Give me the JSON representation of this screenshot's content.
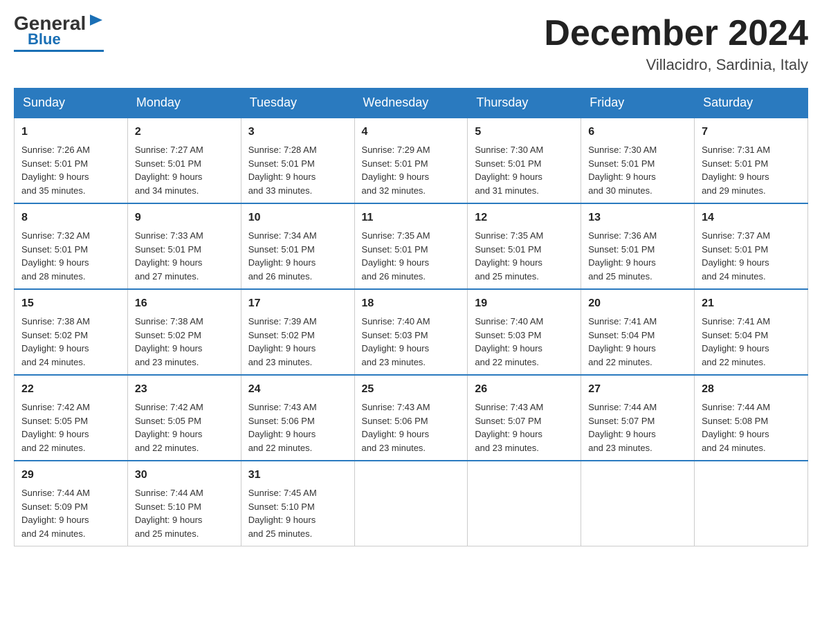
{
  "logo": {
    "general": "General",
    "blue": "Blue"
  },
  "header": {
    "month_year": "December 2024",
    "location": "Villacidro, Sardinia, Italy"
  },
  "weekdays": [
    "Sunday",
    "Monday",
    "Tuesday",
    "Wednesday",
    "Thursday",
    "Friday",
    "Saturday"
  ],
  "weeks": [
    [
      {
        "day": "1",
        "sunrise": "Sunrise: 7:26 AM",
        "sunset": "Sunset: 5:01 PM",
        "daylight": "Daylight: 9 hours",
        "daylight2": "and 35 minutes."
      },
      {
        "day": "2",
        "sunrise": "Sunrise: 7:27 AM",
        "sunset": "Sunset: 5:01 PM",
        "daylight": "Daylight: 9 hours",
        "daylight2": "and 34 minutes."
      },
      {
        "day": "3",
        "sunrise": "Sunrise: 7:28 AM",
        "sunset": "Sunset: 5:01 PM",
        "daylight": "Daylight: 9 hours",
        "daylight2": "and 33 minutes."
      },
      {
        "day": "4",
        "sunrise": "Sunrise: 7:29 AM",
        "sunset": "Sunset: 5:01 PM",
        "daylight": "Daylight: 9 hours",
        "daylight2": "and 32 minutes."
      },
      {
        "day": "5",
        "sunrise": "Sunrise: 7:30 AM",
        "sunset": "Sunset: 5:01 PM",
        "daylight": "Daylight: 9 hours",
        "daylight2": "and 31 minutes."
      },
      {
        "day": "6",
        "sunrise": "Sunrise: 7:30 AM",
        "sunset": "Sunset: 5:01 PM",
        "daylight": "Daylight: 9 hours",
        "daylight2": "and 30 minutes."
      },
      {
        "day": "7",
        "sunrise": "Sunrise: 7:31 AM",
        "sunset": "Sunset: 5:01 PM",
        "daylight": "Daylight: 9 hours",
        "daylight2": "and 29 minutes."
      }
    ],
    [
      {
        "day": "8",
        "sunrise": "Sunrise: 7:32 AM",
        "sunset": "Sunset: 5:01 PM",
        "daylight": "Daylight: 9 hours",
        "daylight2": "and 28 minutes."
      },
      {
        "day": "9",
        "sunrise": "Sunrise: 7:33 AM",
        "sunset": "Sunset: 5:01 PM",
        "daylight": "Daylight: 9 hours",
        "daylight2": "and 27 minutes."
      },
      {
        "day": "10",
        "sunrise": "Sunrise: 7:34 AM",
        "sunset": "Sunset: 5:01 PM",
        "daylight": "Daylight: 9 hours",
        "daylight2": "and 26 minutes."
      },
      {
        "day": "11",
        "sunrise": "Sunrise: 7:35 AM",
        "sunset": "Sunset: 5:01 PM",
        "daylight": "Daylight: 9 hours",
        "daylight2": "and 26 minutes."
      },
      {
        "day": "12",
        "sunrise": "Sunrise: 7:35 AM",
        "sunset": "Sunset: 5:01 PM",
        "daylight": "Daylight: 9 hours",
        "daylight2": "and 25 minutes."
      },
      {
        "day": "13",
        "sunrise": "Sunrise: 7:36 AM",
        "sunset": "Sunset: 5:01 PM",
        "daylight": "Daylight: 9 hours",
        "daylight2": "and 25 minutes."
      },
      {
        "day": "14",
        "sunrise": "Sunrise: 7:37 AM",
        "sunset": "Sunset: 5:01 PM",
        "daylight": "Daylight: 9 hours",
        "daylight2": "and 24 minutes."
      }
    ],
    [
      {
        "day": "15",
        "sunrise": "Sunrise: 7:38 AM",
        "sunset": "Sunset: 5:02 PM",
        "daylight": "Daylight: 9 hours",
        "daylight2": "and 24 minutes."
      },
      {
        "day": "16",
        "sunrise": "Sunrise: 7:38 AM",
        "sunset": "Sunset: 5:02 PM",
        "daylight": "Daylight: 9 hours",
        "daylight2": "and 23 minutes."
      },
      {
        "day": "17",
        "sunrise": "Sunrise: 7:39 AM",
        "sunset": "Sunset: 5:02 PM",
        "daylight": "Daylight: 9 hours",
        "daylight2": "and 23 minutes."
      },
      {
        "day": "18",
        "sunrise": "Sunrise: 7:40 AM",
        "sunset": "Sunset: 5:03 PM",
        "daylight": "Daylight: 9 hours",
        "daylight2": "and 23 minutes."
      },
      {
        "day": "19",
        "sunrise": "Sunrise: 7:40 AM",
        "sunset": "Sunset: 5:03 PM",
        "daylight": "Daylight: 9 hours",
        "daylight2": "and 22 minutes."
      },
      {
        "day": "20",
        "sunrise": "Sunrise: 7:41 AM",
        "sunset": "Sunset: 5:04 PM",
        "daylight": "Daylight: 9 hours",
        "daylight2": "and 22 minutes."
      },
      {
        "day": "21",
        "sunrise": "Sunrise: 7:41 AM",
        "sunset": "Sunset: 5:04 PM",
        "daylight": "Daylight: 9 hours",
        "daylight2": "and 22 minutes."
      }
    ],
    [
      {
        "day": "22",
        "sunrise": "Sunrise: 7:42 AM",
        "sunset": "Sunset: 5:05 PM",
        "daylight": "Daylight: 9 hours",
        "daylight2": "and 22 minutes."
      },
      {
        "day": "23",
        "sunrise": "Sunrise: 7:42 AM",
        "sunset": "Sunset: 5:05 PM",
        "daylight": "Daylight: 9 hours",
        "daylight2": "and 22 minutes."
      },
      {
        "day": "24",
        "sunrise": "Sunrise: 7:43 AM",
        "sunset": "Sunset: 5:06 PM",
        "daylight": "Daylight: 9 hours",
        "daylight2": "and 22 minutes."
      },
      {
        "day": "25",
        "sunrise": "Sunrise: 7:43 AM",
        "sunset": "Sunset: 5:06 PM",
        "daylight": "Daylight: 9 hours",
        "daylight2": "and 23 minutes."
      },
      {
        "day": "26",
        "sunrise": "Sunrise: 7:43 AM",
        "sunset": "Sunset: 5:07 PM",
        "daylight": "Daylight: 9 hours",
        "daylight2": "and 23 minutes."
      },
      {
        "day": "27",
        "sunrise": "Sunrise: 7:44 AM",
        "sunset": "Sunset: 5:07 PM",
        "daylight": "Daylight: 9 hours",
        "daylight2": "and 23 minutes."
      },
      {
        "day": "28",
        "sunrise": "Sunrise: 7:44 AM",
        "sunset": "Sunset: 5:08 PM",
        "daylight": "Daylight: 9 hours",
        "daylight2": "and 24 minutes."
      }
    ],
    [
      {
        "day": "29",
        "sunrise": "Sunrise: 7:44 AM",
        "sunset": "Sunset: 5:09 PM",
        "daylight": "Daylight: 9 hours",
        "daylight2": "and 24 minutes."
      },
      {
        "day": "30",
        "sunrise": "Sunrise: 7:44 AM",
        "sunset": "Sunset: 5:10 PM",
        "daylight": "Daylight: 9 hours",
        "daylight2": "and 25 minutes."
      },
      {
        "day": "31",
        "sunrise": "Sunrise: 7:45 AM",
        "sunset": "Sunset: 5:10 PM",
        "daylight": "Daylight: 9 hours",
        "daylight2": "and 25 minutes."
      },
      null,
      null,
      null,
      null
    ]
  ]
}
